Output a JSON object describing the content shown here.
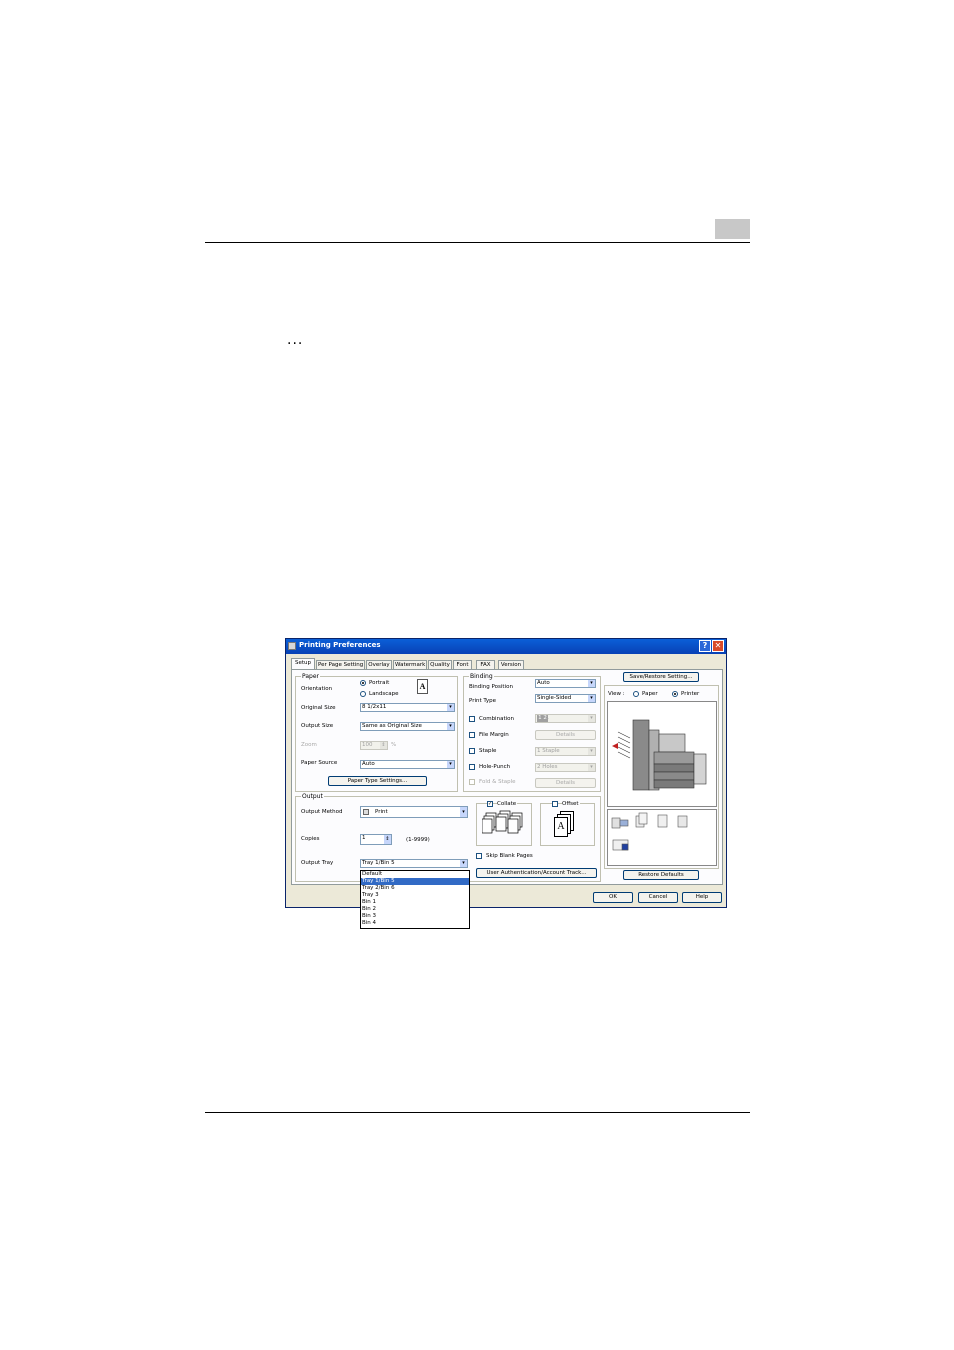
{
  "dialog": {
    "title": "Printing Preferences",
    "help_glyph": "?",
    "close_glyph": "✕",
    "tabs": [
      "Setup",
      "Per Page Setting",
      "Overlay",
      "Watermark",
      "Quality",
      "Font",
      "FAX",
      "Version"
    ],
    "active_tab": "Setup",
    "paper": {
      "group_label": "Paper",
      "orientation_label": "Orientation",
      "portrait_label": "Portrait",
      "landscape_label": "Landscape",
      "orientation_selected": "Portrait",
      "orientation_icon_glyph": "A",
      "original_size_label": "Original Size",
      "original_size_value": "8 1/2x11",
      "output_size_label": "Output Size",
      "output_size_value": "Same as Original Size",
      "zoom_label": "Zoom",
      "zoom_value": "100",
      "zoom_unit": "%",
      "paper_source_label": "Paper Source",
      "paper_source_value": "Auto",
      "paper_type_button": "Paper Type Settings..."
    },
    "binding": {
      "group_label": "Binding",
      "binding_position_label": "Binding Position",
      "binding_position_value": "Auto",
      "print_type_label": "Print Type",
      "print_type_value": "Single-Sided",
      "combination_label": "Combination",
      "combination_value": "2in1",
      "combination_badge": "1 2",
      "file_margin_label": "File Margin",
      "staple_label": "Staple",
      "staple_value": "1 Staple",
      "hole_punch_label": "Hole-Punch",
      "hole_punch_value": "2 Holes",
      "fold_staple_label": "Fold & Staple",
      "details_label": "Details"
    },
    "output": {
      "group_label": "Output",
      "output_method_label": "Output Method",
      "output_method_value": "Print",
      "copies_label": "Copies",
      "copies_value": "1",
      "copies_range": "(1-9999)",
      "output_tray_label": "Output Tray",
      "output_tray_value": "Tray 1/Bin 5",
      "tray_options": [
        "Default",
        "Tray 1/Bin 5",
        "Tray 2/Bin 6",
        "Tray 3",
        "Bin 1",
        "Bin 2",
        "Bin 3",
        "Bin 4"
      ],
      "tray_highlighted": "Tray 1/Bin 5",
      "collate_label": "Collate",
      "collate_checked": true,
      "offset_label": "Offset",
      "offset_checked": false,
      "offset_icon_glyph": "A",
      "skip_blank_label": "Skip Blank Pages",
      "user_auth_button": "User Authentication/Account Track..."
    },
    "preview": {
      "save_restore_button": "Save/Restore Setting...",
      "view_label": "View :",
      "paper_label": "Paper",
      "printer_label": "Printer",
      "view_selected": "Printer",
      "restore_defaults_button": "Restore Defaults"
    },
    "footer": {
      "ok": "OK",
      "cancel": "Cancel",
      "help": "Help"
    }
  },
  "page": {
    "continuation_mark": "..."
  },
  "colors": {
    "titlebar": "#0a5fd8",
    "dialog_face": "#ece9d8",
    "selection": "#316ac5",
    "chapter_box": "#c8c8c8"
  }
}
